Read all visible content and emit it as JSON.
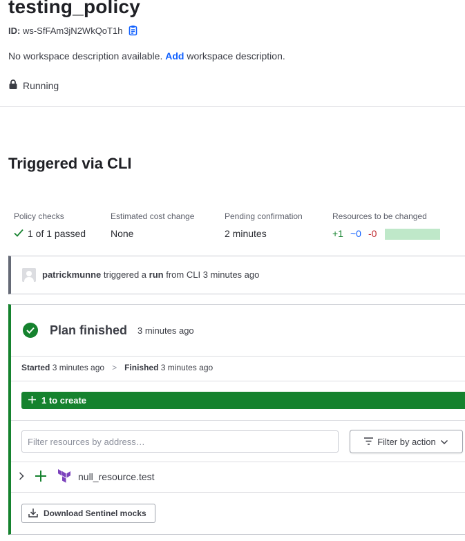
{
  "workspace": {
    "name": "testing_policy",
    "id_label": "ID:",
    "id_value": "ws-SfFAm3jN2WkQoT1h",
    "description_prefix": "No workspace description available.",
    "description_link": "Add",
    "description_suffix": "workspace description.",
    "status": "Running"
  },
  "run": {
    "title": "Triggered via CLI",
    "metrics": {
      "policy_checks_label": "Policy checks",
      "policy_checks_value": "1 of 1 passed",
      "cost_label": "Estimated cost change",
      "cost_value": "None",
      "pending_label": "Pending confirmation",
      "pending_value": "2 minutes",
      "resources_label": "Resources to be changed",
      "res_add": "+1",
      "res_change": "~0",
      "res_destroy": "-0"
    },
    "trigger": {
      "user": "patrickmunne",
      "text1": "triggered a",
      "run_word": "run",
      "text2": "from CLI 3 minutes ago"
    }
  },
  "plan": {
    "title": "Plan finished",
    "time": "3 minutes ago",
    "started_label": "Started",
    "started_time": "3 minutes ago",
    "arrow": ">",
    "finished_label": "Finished",
    "finished_time": "3 minutes ago",
    "create_label": "1 to create",
    "filter_placeholder": "Filter resources by address…",
    "filter_button": "Filter by action",
    "resource_name": "null_resource.test",
    "download_button": "Download Sentinel mocks"
  },
  "colors": {
    "success": "#15822e",
    "link": "#1060ff",
    "destroy": "#c0282d",
    "terraform_purple": "#7b42bc"
  }
}
